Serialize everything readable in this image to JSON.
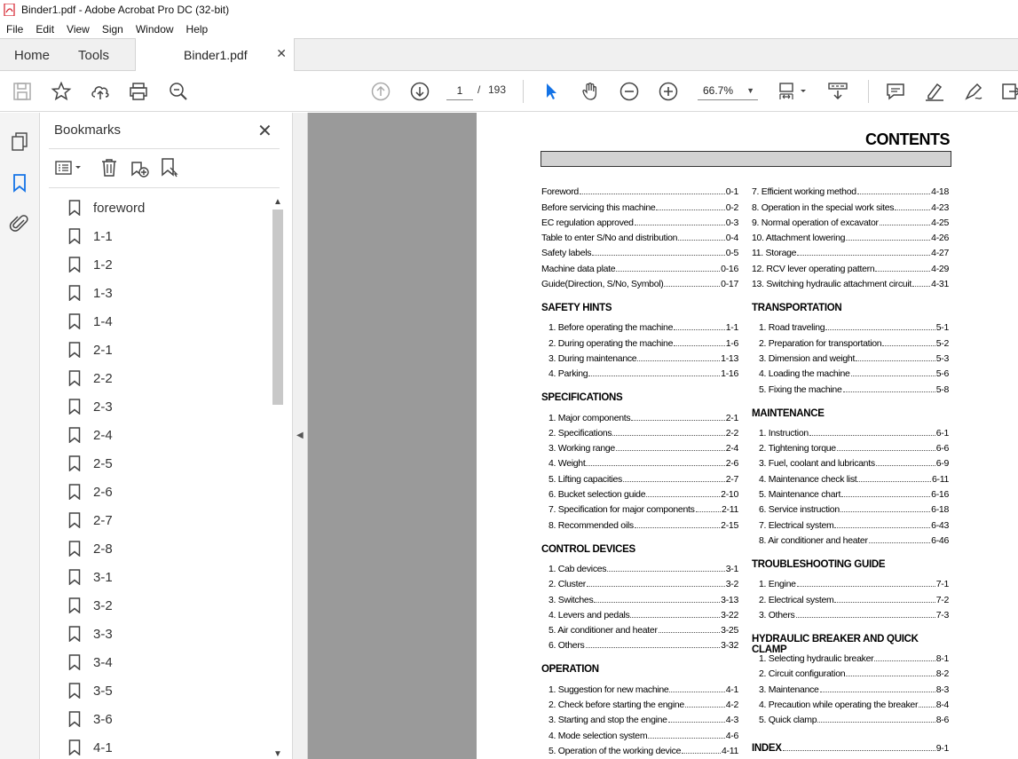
{
  "window": {
    "title": "Binder1.pdf - Adobe Acrobat Pro DC (32-bit)"
  },
  "menu": [
    "File",
    "Edit",
    "View",
    "Sign",
    "Window",
    "Help"
  ],
  "tabs": {
    "home": "Home",
    "tools": "Tools",
    "document": "Binder1.pdf"
  },
  "toolbar": {
    "page_current": "1",
    "page_sep": "/",
    "page_total": "193",
    "zoom": "66.7%"
  },
  "bookmarks": {
    "title": "Bookmarks",
    "items": [
      "foreword",
      "1-1",
      "1-2",
      "1-3",
      "1-4",
      "2-1",
      "2-2",
      "2-3",
      "2-4",
      "2-5",
      "2-6",
      "2-7",
      "2-8",
      "3-1",
      "3-2",
      "3-3",
      "3-4",
      "3-5",
      "3-6",
      "4-1"
    ]
  },
  "pdf": {
    "title": "CONTENTS",
    "left": [
      {
        "entries": [
          [
            "Foreword",
            "0-1"
          ],
          [
            "Before servicing this machine",
            "0-2"
          ],
          [
            "EC regulation approved",
            "0-3"
          ],
          [
            "Table to enter S/No and distribution",
            "0-4"
          ],
          [
            "Safety labels",
            "0-5"
          ],
          [
            "Machine data plate",
            "0-16"
          ],
          [
            "Guide(Direction, S/No, Symbol)",
            "0-17"
          ]
        ]
      },
      {
        "heading": "SAFETY HINTS",
        "entries": [
          [
            "1. Before operating the machine",
            "1-1"
          ],
          [
            "2. During operating the machine",
            "1-6"
          ],
          [
            "3. During maintenance",
            "1-13"
          ],
          [
            "4. Parking",
            "1-16"
          ]
        ]
      },
      {
        "heading": "SPECIFICATIONS",
        "entries": [
          [
            "1. Major components",
            "2-1"
          ],
          [
            "2. Specifications",
            "2-2"
          ],
          [
            "3. Working range",
            "2-4"
          ],
          [
            "4. Weight",
            "2-6"
          ],
          [
            "5. Lifting capacities",
            "2-7"
          ],
          [
            "6. Bucket selection guide",
            "2-10"
          ],
          [
            "7. Specification for major components",
            "2-11"
          ],
          [
            "8. Recommended oils",
            "2-15"
          ]
        ]
      },
      {
        "heading": "CONTROL DEVICES",
        "entries": [
          [
            "1. Cab devices",
            "3-1"
          ],
          [
            "2. Cluster",
            "3-2"
          ],
          [
            "3. Switches",
            "3-13"
          ],
          [
            "4. Levers and pedals",
            "3-22"
          ],
          [
            "5. Air conditioner and heater",
            "3-25"
          ],
          [
            "6. Others",
            "3-32"
          ]
        ]
      },
      {
        "heading": "OPERATION",
        "entries": [
          [
            "1. Suggestion for new machine",
            "4-1"
          ],
          [
            "2. Check before starting the engine",
            "4-2"
          ],
          [
            "3. Starting and stop the engine",
            "4-3"
          ],
          [
            "4. Mode selection system",
            "4-6"
          ],
          [
            "5. Operation of the working device",
            "4-11"
          ]
        ]
      }
    ],
    "right": [
      {
        "entries": [
          [
            "7. Efficient working method",
            "4-18"
          ],
          [
            "8. Operation in the special work sites",
            "4-23"
          ],
          [
            "9. Normal operation of excavator",
            "4-25"
          ],
          [
            "10. Attachment lowering",
            "4-26"
          ],
          [
            "11. Storage",
            "4-27"
          ],
          [
            "12. RCV lever operating pattern",
            "4-29"
          ],
          [
            "13. Switching hydraulic attachment circuit",
            "4-31"
          ]
        ]
      },
      {
        "heading": "TRANSPORTATION",
        "entries": [
          [
            "1. Road traveling",
            "5-1"
          ],
          [
            "2. Preparation for transportation",
            "5-2"
          ],
          [
            "3. Dimension and weight",
            "5-3"
          ],
          [
            "4. Loading the machine",
            "5-6"
          ],
          [
            "5. Fixing the machine",
            "5-8"
          ]
        ]
      },
      {
        "heading": "MAINTENANCE",
        "entries": [
          [
            "1. Instruction",
            "6-1"
          ],
          [
            "2. Tightening torque",
            "6-6"
          ],
          [
            "3. Fuel, coolant and lubricants",
            "6-9"
          ],
          [
            "4. Maintenance check list",
            "6-11"
          ],
          [
            "5. Maintenance chart",
            "6-16"
          ],
          [
            "6. Service instruction",
            "6-18"
          ],
          [
            "7. Electrical system",
            "6-43"
          ],
          [
            "8. Air conditioner and heater",
            "6-46"
          ]
        ]
      },
      {
        "heading": "TROUBLESHOOTING GUIDE",
        "entries": [
          [
            "1. Engine",
            "7-1"
          ],
          [
            "2. Electrical system",
            "7-2"
          ],
          [
            "3. Others",
            "7-3"
          ]
        ]
      },
      {
        "heading": "HYDRAULIC BREAKER AND QUICK CLAMP",
        "entries": [
          [
            "1. Selecting hydraulic breaker",
            "8-1"
          ],
          [
            "2. Circuit configuration",
            "8-2"
          ],
          [
            "3. Maintenance",
            "8-3"
          ],
          [
            "4. Precaution while operating the breaker",
            "8-4"
          ],
          [
            "5. Quick clamp",
            "8-6"
          ]
        ]
      },
      {
        "heading": "INDEX",
        "entries": [],
        "page": "9-1"
      }
    ]
  }
}
